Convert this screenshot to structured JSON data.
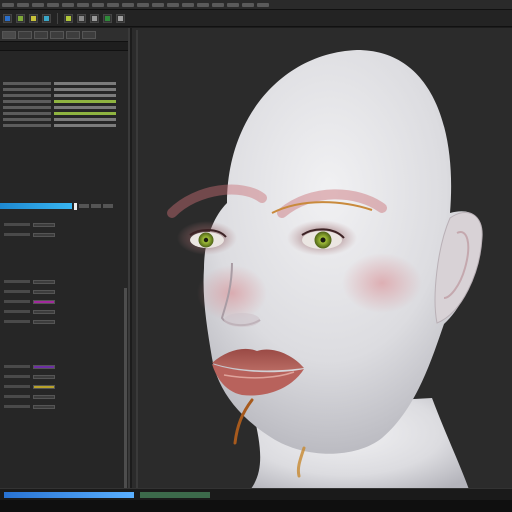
{
  "app": {
    "accent": "#1e88d0",
    "viewport_bg": "#2b2b2b"
  },
  "menubar": {
    "items": [
      "",
      "",
      "",
      "",
      "",
      "",
      "",
      "",
      "",
      "",
      "",
      "",
      "",
      "",
      "",
      "",
      "",
      "",
      "",
      ""
    ]
  },
  "toolbar": {
    "buttons": [
      {
        "icon": "select-icon",
        "color": "#2b6fc9"
      },
      {
        "icon": "move-icon",
        "color": "#7fa93a"
      },
      {
        "icon": "rotate-icon",
        "color": "#c8c23a"
      },
      {
        "icon": "scale-icon",
        "color": "#3aa7c8"
      },
      {
        "icon": "snap-icon",
        "color": "#b2c83a"
      },
      {
        "icon": "grid-icon",
        "color": "#8a8a8a"
      },
      {
        "icon": "camera-icon",
        "color": "#9a9a9a"
      },
      {
        "icon": "render-icon",
        "color": "#2f8a3a"
      },
      {
        "icon": "light-icon",
        "color": "#a0a0a0"
      }
    ]
  },
  "left_panel": {
    "section_title": "",
    "slider_fraction": 0.9
  },
  "status": {
    "text": "",
    "fields": [
      "",
      "",
      ""
    ]
  }
}
